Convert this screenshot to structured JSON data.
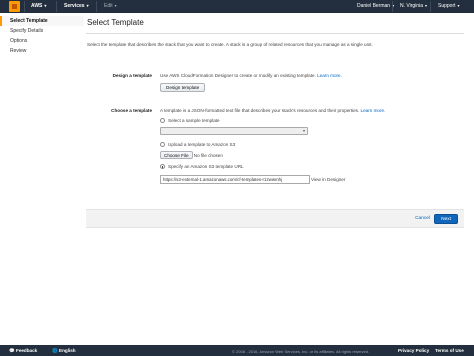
{
  "topbar": {
    "brand": "AWS",
    "services": "Services",
    "edit": "Edit",
    "user": "Daniel Berman",
    "region": "N. Virginia",
    "support": "Support"
  },
  "sidenav": {
    "items": [
      {
        "label": "Select Template"
      },
      {
        "label": "Specify Details"
      },
      {
        "label": "Options"
      },
      {
        "label": "Review"
      }
    ]
  },
  "main": {
    "title": "Select Template",
    "description": "Select the template that describes the stack that you want to create. A stack is a group of related resources that you manage as a single unit.",
    "design": {
      "label": "Design a template",
      "text": "Use AWS CloudFormation Designer to create or modify an existing template.",
      "learn_more": "Learn more.",
      "button": "Design template"
    },
    "choose": {
      "label": "Choose a template",
      "text": "A template is a JSON-formatted text file that describes your stack's resources and their properties.",
      "learn_more": "Learn more.",
      "option_sample": "Select a sample template",
      "option_upload": "Upload a template to Amazon S3",
      "choose_file": "Choose File",
      "no_file": "No file chosen",
      "option_url": "Specify an Amazon S3 template URL",
      "url_value": "https://s3-external-1.amazonaws.com/cf-templates-r1zwwmhj",
      "view_designer": "View in Designer"
    },
    "footer": {
      "cancel": "Cancel",
      "next": "Next"
    }
  },
  "bottombar": {
    "feedback": "Feedback",
    "language": "English",
    "copyright": "© 2008 - 2016, Amazon Web Services, Inc. or its affiliates. All rights reserved.",
    "privacy": "Privacy Policy",
    "terms": "Terms of Use"
  }
}
